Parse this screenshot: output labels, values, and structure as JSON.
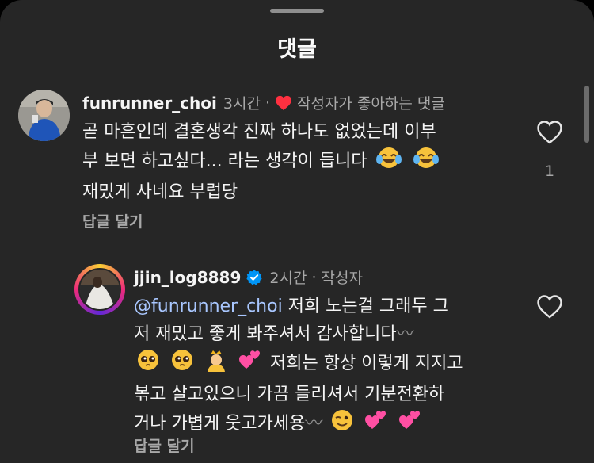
{
  "header": {
    "title": "댓글"
  },
  "comments": [
    {
      "username": "funrunner_choi",
      "time": "3시간",
      "author_liked_label": "작성자가 좋아하는 댓글",
      "text_lines": [
        "곧 마흔인데 결혼생각 진짜 하나도 없었는데 이부",
        "부 보면 하고싶다... 라는 생각이 듭니다",
        "재밌게 사네요 부럽당"
      ],
      "emojis_line2": [
        "face-with-tears-of-joy",
        "face-with-tears-of-joy"
      ],
      "like_count": "1",
      "reply_label": "답글 달기"
    }
  ],
  "replies": [
    {
      "username": "jjin_log8889",
      "verified": true,
      "time": "2시간",
      "author_badge": "작성자",
      "mention": "@funrunner_choi",
      "line1_rest": " 저희 노는걸 그래두 그",
      "line2": "저 재밌고 좋게 봐주셔서 감사합니다",
      "wave1": "〰",
      "line3_text": "저희는 항상 이렇게 지지고",
      "line4": "볶고 살고있으니 가끔 들리셔서 기분전환하",
      "line5": "거나 가볍게 웃고가세용",
      "wave2": "〰",
      "emojis_line3": [
        "pleading-face",
        "pleading-face",
        "person-with-crown",
        "two-hearts"
      ],
      "emojis_line5": [
        "winking-face",
        "two-hearts",
        "two-hearts"
      ],
      "reply_label": "답글 달기"
    }
  ],
  "colors": {
    "sheet": "#262626",
    "heart": "#ff3040",
    "verified": "#0095f6",
    "mention": "#a9c7ff"
  }
}
